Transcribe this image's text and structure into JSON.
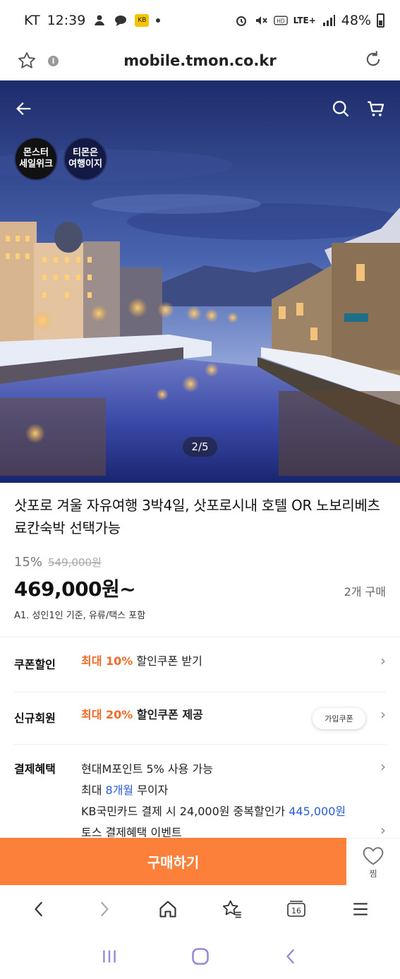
{
  "status_bar": {
    "carrier": "KT",
    "time": "12:39",
    "kakao_badge": "KB",
    "network": "LTE+",
    "battery": "48%"
  },
  "url_bar": {
    "url": "mobile.tmon.co.kr"
  },
  "hero": {
    "badge_monster": "몬스터\n세일위크",
    "badge_travel": "티몬은\n여행이지",
    "pager": "2/5"
  },
  "product": {
    "title": "삿포로 겨울 자유여행 3박4일, 삿포로시내 호텔 OR 노보리베츠 료칸숙박 선택가능",
    "discount": "15%",
    "original_price": "549,000원",
    "price": "469,000원~",
    "sold_count": "2개 구매",
    "note": "A1. 성인1인 기준, 유류/택스 포함"
  },
  "benefits": {
    "coupon": {
      "label": "쿠폰할인",
      "highlight": "최대 10%",
      "text": " 할인쿠폰 받기"
    },
    "new_member": {
      "label": "신규회원",
      "highlight": "최대 20%",
      "text": " 할인쿠폰 제공",
      "tag": "가입쿠폰"
    },
    "payment": {
      "label": "결제혜택",
      "line1": "현대M포인트 5% 사용 가능",
      "line2_prefix": "최대 ",
      "line2_highlight": "8개월",
      "line2_suffix": " 무이자",
      "line3_prefix": "KB국민카드 결제 시 24,000원 중복할인가 ",
      "line3_highlight": "445,000원",
      "line4": "토스 결제혜택 이벤트"
    }
  },
  "buy_bar": {
    "buy_label": "구매하기",
    "wish_label": "찜"
  },
  "browser_nav": {
    "tab_count": "16"
  },
  "colors": {
    "accent_orange": "#fc7f3a",
    "highlight_orange": "#f06a28",
    "highlight_blue": "#2a5bd7"
  }
}
